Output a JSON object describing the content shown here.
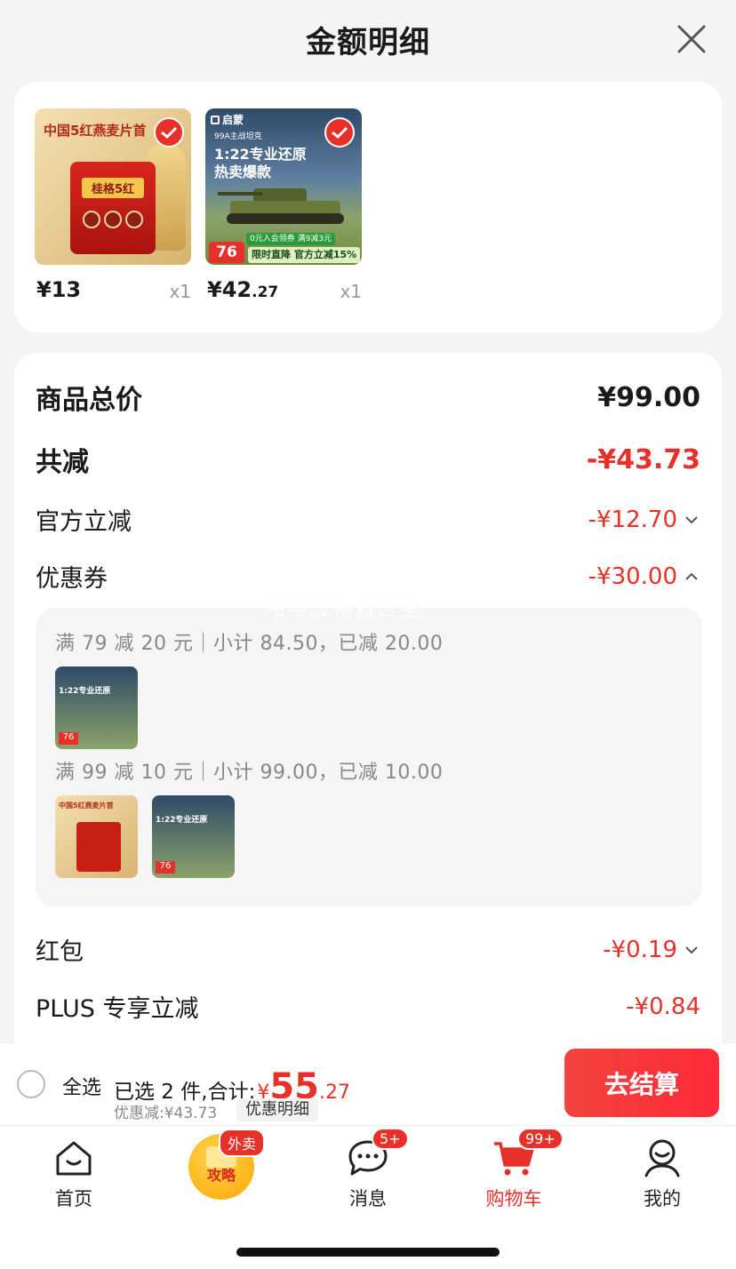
{
  "header": {
    "title": "金额明细"
  },
  "products": [
    {
      "price_int": "¥13",
      "price_dec": "",
      "qty": "x1",
      "banner": "中国5红燕麦片首",
      "pack_text": "桂格5红"
    },
    {
      "price_int": "¥42",
      "price_dec": ".27",
      "qty": "x1",
      "brand": "启蒙",
      "top_text": "99A主战坦克",
      "headline_1": "1:22专业还原",
      "headline_2": "热卖爆款",
      "promo_price": "76",
      "promo_label": "限时直降",
      "promo_sub": "官方立减15%",
      "promo_note": "0元入会领券 满9减3元"
    }
  ],
  "summary": {
    "total_label": "商品总价",
    "total_value": "¥99.00",
    "reduce_label": "共减",
    "reduce_value": "-¥43.73",
    "official_label": "官方立减",
    "official_value": "-¥12.70",
    "coupon_label": "优惠券",
    "coupon_value": "-¥30.00",
    "watermark": "哈喽波特救世主",
    "coupon_line_1": "满 79 减 20 元｜小计 84.50，已减 20.00",
    "coupon_line_2": "满 99 减 10 元｜小计 99.00，已减 10.00",
    "redpacket_label": "红包",
    "redpacket_value": "-¥0.19",
    "plus_label": "PLUS 专享立减",
    "plus_value": "-¥0.84"
  },
  "footer": {
    "select_all": "全选",
    "selected_text": "已选 2 件,合计:",
    "currency": "¥",
    "total_int": "55",
    "total_dec": ".27",
    "discount_text": "优惠减:¥43.73",
    "detail_chip": "优惠明细",
    "checkout": "去结算"
  },
  "tabbar": {
    "home": "首页",
    "promo_badge": "外卖",
    "promo_text": "攻略",
    "messages": "消息",
    "messages_badge": "5+",
    "cart": "购物车",
    "cart_badge": "99+",
    "mine": "我的"
  },
  "colors": {
    "accent": "#e8302a",
    "background": "#f4f4f4"
  }
}
